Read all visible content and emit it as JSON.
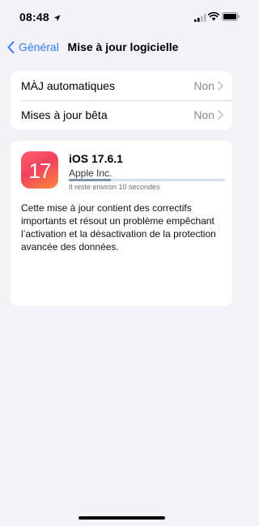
{
  "status": {
    "time": "08:48"
  },
  "nav": {
    "back_label": "Général",
    "title": "Mise à jour logicielle"
  },
  "settings": {
    "rows": [
      {
        "label": "MÀJ automatiques",
        "value": "Non"
      },
      {
        "label": "Mises à jour bêta",
        "value": "Non"
      }
    ]
  },
  "update": {
    "icon_text": "17",
    "name": "iOS 17.6.1",
    "vendor": "Apple Inc.",
    "progress": 0.27,
    "remaining": "Il reste environ 10 secondes",
    "description": "Cette mise à jour contient des correctifs importants et résout un problème empêchant l’activation et la désactivation de la protection avancée des données."
  },
  "colors": {
    "accent": "#3478f6",
    "background": "#f2f2f7"
  }
}
